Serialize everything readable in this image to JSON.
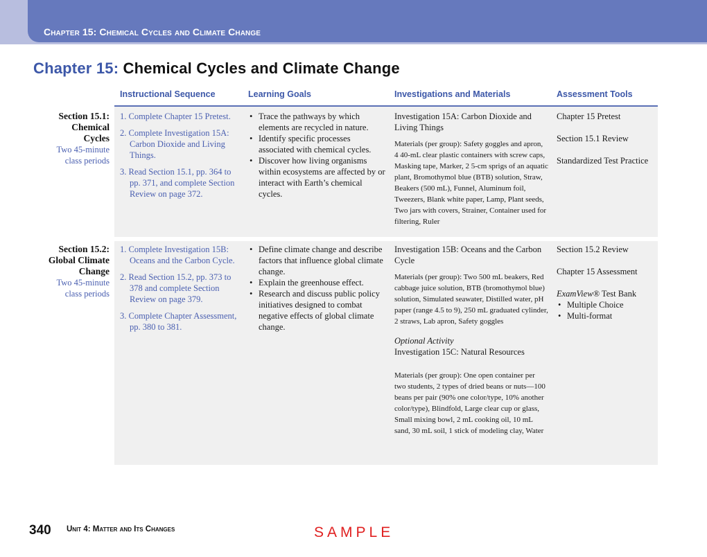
{
  "header": {
    "running_title": "Chapter 15: Chemical Cycles and Climate Change"
  },
  "title": {
    "chapter_label": "Chapter 15:",
    "chapter_name": "Chemical Cycles and Climate Change"
  },
  "columns": [
    "Instructional Sequence",
    "Learning Goals",
    "Investigations and Materials",
    "Assessment Tools"
  ],
  "sections": [
    {
      "title_lines": [
        "Section 15.1:",
        "Chemical",
        "Cycles"
      ],
      "time_lines": [
        "Two 45-minute",
        "class periods"
      ],
      "sequence": [
        "1. Complete Chapter 15 Pretest.",
        "2. Complete Investigation 15A: Carbon Dioxide and Living Things.",
        "3. Read Section 15.1, pp. 364 to pp.  371, and complete Section Review on page 372."
      ],
      "goals": [
        "Trace the pathways by which elements are recycled in nature.",
        "Identify specific processes associated with chemical cycles.",
        "Discover how living organisms within ecosystems are affected by or interact with Earth’s chemical cycles."
      ],
      "investigation": {
        "title": "Investigation 15A: Carbon Dioxide and Living Things",
        "materials": "Materials (per group): Safety goggles and apron, 4 40-mL clear plastic containers with screw caps, Masking tape, Marker, 2 5-cm sprigs of an aquatic plant, Bromothymol blue (BTB) solution, Straw, Beakers (500 mL), Funnel, Aluminum foil, Tweezers, Blank white paper, Lamp, Plant seeds, Two jars with covers, Strainer, Container used for filtering, Ruler"
      },
      "assessment": [
        "Chapter 15 Pretest",
        "Section 15.1 Review",
        "Standardized Test Practice"
      ]
    },
    {
      "title_lines": [
        "Section 15.2:",
        "Global Climate",
        "Change"
      ],
      "time_lines": [
        "Two 45-minute",
        "class periods"
      ],
      "sequence": [
        "1. Complete Investigation 15B: Oceans and the Carbon Cycle.",
        "2. Read Section 15.2, pp. 373 to 378 and complete Section Review on page 379.",
        "3. Complete Chapter Assessment, pp. 380 to 381."
      ],
      "goals": [
        "Define climate change and describe factors that influence global climate change.",
        "Explain the greenhouse effect.",
        "Research and discuss public policy initiatives designed to combat negative effects of global climate change."
      ],
      "investigation": {
        "title": "Investigation 15B: Oceans and the Carbon Cycle",
        "materials": "Materials (per group): Two 500 mL beakers, Red cabbage juice solution, BTB (bromothymol blue) solution, Simulated seawater, Distilled water, pH paper (range 4.5 to 9), 250 mL graduated cylinder, 2 straws, Lab apron, Safety goggles",
        "optional_label": "Optional Activity",
        "optional_title": "Investigation 15C: Natural Resources",
        "optional_materials": "Materials (per group): One open container per two students, 2 types of dried beans or nuts—100 beans per pair (90% one color/type, 10% another color/type), Blindfold, Large clear cup or glass, Small mixing bowl, 2 mL cooking oil, 10 mL sand, 30 mL soil, 1 stick of modeling clay, Water"
      },
      "assessment": [
        "Section 15.2 Review",
        "Chapter 15 Assessment"
      ],
      "examview_brand": "ExamView®",
      "examview_rest": " Test Bank",
      "examview_items": [
        "Multiple Choice",
        "Multi-format"
      ]
    }
  ],
  "footer": {
    "page_number": "340",
    "unit": "Unit 4: Matter and Its Changes",
    "watermark": "SAMPLE"
  }
}
